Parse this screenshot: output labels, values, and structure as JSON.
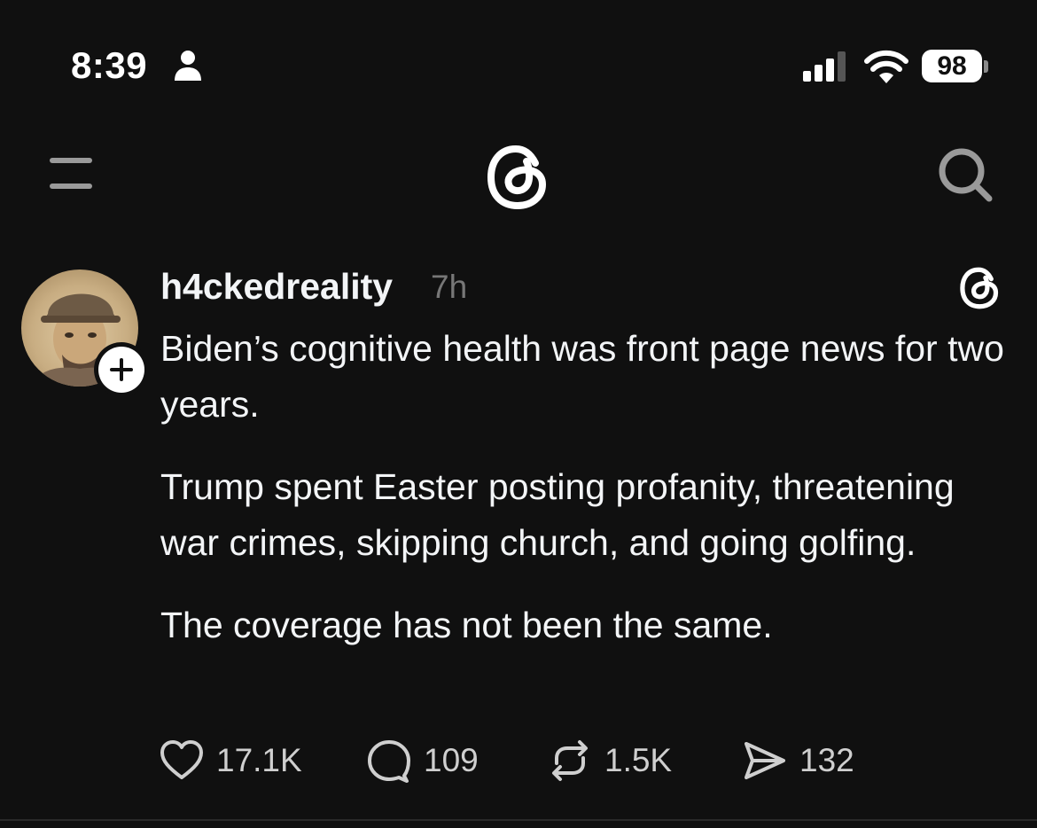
{
  "status_bar": {
    "time": "8:39",
    "battery": "98",
    "icons": [
      "person-icon",
      "signal-icon",
      "wifi-icon",
      "battery-icon"
    ]
  },
  "nav": {
    "icons": [
      "menu-icon",
      "threads-logo-icon",
      "search-icon"
    ]
  },
  "post": {
    "username": "h4ckedreality",
    "time_ago": "7h",
    "paragraphs": [
      "Biden’s cognitive health was front page news for two years.",
      "Trump spent Easter posting profanity, threatening war crimes, skipping church, and going golfing.",
      "The coverage has not been the same."
    ],
    "likes": "17.1K",
    "replies": "109",
    "reposts": "1.5K",
    "shares": "132"
  },
  "colors": {
    "background": "#101010",
    "text": "#f3f5f7",
    "muted": "#777777"
  }
}
